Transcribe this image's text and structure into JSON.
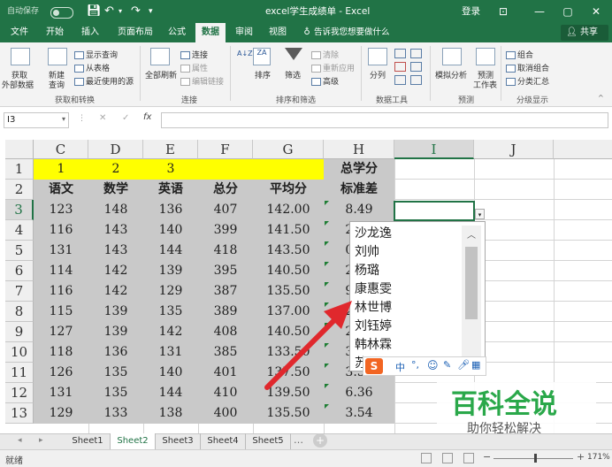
{
  "window": {
    "autosave_label": "自动保存",
    "autosave_state": "关",
    "title": "excel学生成绩单 - Excel",
    "login": "登录",
    "minimize": "—",
    "restore": "▢",
    "close": "✕"
  },
  "tabs": [
    "文件",
    "开始",
    "插入",
    "页面布局",
    "公式",
    "数据",
    "审阅",
    "视图"
  ],
  "tell_me": "告诉我您想要做什么",
  "share": "共享",
  "ribbon": {
    "get_data": "获取\n外部数据",
    "get_data1": "获取",
    "get_data2": "外部数据",
    "new_query1": "新建",
    "new_query2": "查询",
    "show_query": "显示查询",
    "from_table": "从表格",
    "recent_sources": "最近使用的源",
    "group_get": "获取和转换",
    "refresh_all1": "全部刷新",
    "connections": "连接",
    "properties": "属性",
    "edit_links": "编辑链接",
    "group_conn": "连接",
    "sort_az": "A↓Z",
    "sort": "排序",
    "filter": "筛选",
    "clear": "清除",
    "reapply": "重新应用",
    "advanced": "高级",
    "group_sort": "排序和筛选",
    "split": "分列",
    "group_tools": "数据工具",
    "whatif": "模拟分析",
    "forecast1": "预测",
    "forecast2": "工作表",
    "group_forecast": "预测",
    "group": "组合",
    "ungroup": "取消组合",
    "subtotal": "分类汇总",
    "group_outline": "分级显示"
  },
  "formula_bar": {
    "namebox": "I3",
    "cancel": "✕",
    "enter": "✓",
    "fx": "fx",
    "formula": ""
  },
  "columns": [
    "C",
    "D",
    "E",
    "F",
    "G",
    "H",
    "I",
    "J"
  ],
  "rows": [
    "1",
    "2",
    "3",
    "4",
    "5",
    "6",
    "7",
    "8",
    "9",
    "10",
    "11",
    "12",
    "13"
  ],
  "row1": [
    "1",
    "2",
    "3"
  ],
  "h_row1": "总学分",
  "headers": [
    "语文",
    "数学",
    "英语",
    "总分",
    "平均分",
    "标准差"
  ],
  "data": [
    [
      "123",
      "148",
      "136",
      "407",
      "142.00",
      "8.49"
    ],
    [
      "116",
      "143",
      "140",
      "399",
      "141.50",
      "2.12"
    ],
    [
      "131",
      "143",
      "144",
      "418",
      "143.50",
      "0.71"
    ],
    [
      "114",
      "142",
      "139",
      "395",
      "140.50",
      "2.12"
    ],
    [
      "116",
      "142",
      "129",
      "387",
      "135.50",
      "9.19"
    ],
    [
      "115",
      "139",
      "135",
      "389",
      "137.00",
      "2.83"
    ],
    [
      "127",
      "139",
      "142",
      "408",
      "140.50",
      "2.12"
    ],
    [
      "118",
      "136",
      "131",
      "385",
      "133.50",
      "3.54"
    ],
    [
      "126",
      "135",
      "140",
      "401",
      "137.50",
      "3.54"
    ],
    [
      "131",
      "135",
      "144",
      "410",
      "139.50",
      "6.36"
    ],
    [
      "129",
      "133",
      "138",
      "400",
      "135.50",
      "3.54"
    ]
  ],
  "dropdown_items": [
    "沙龙逸",
    "刘帅",
    "杨璐",
    "康惠雯",
    "林世博",
    "刘钰婷",
    "韩林霖",
    "苏"
  ],
  "sheets": [
    "Sheet1",
    "Sheet2",
    "Sheet3",
    "Sheet4",
    "Sheet5"
  ],
  "active_sheet": "Sheet2",
  "status": {
    "ready": "就绪",
    "zoom": "171%",
    "minus": "−",
    "plus": "+"
  },
  "watermark": {
    "title": "百科全说",
    "subtitle": "助你轻松解决"
  },
  "ime_bar": {
    "s": "S",
    "zh": "中"
  }
}
